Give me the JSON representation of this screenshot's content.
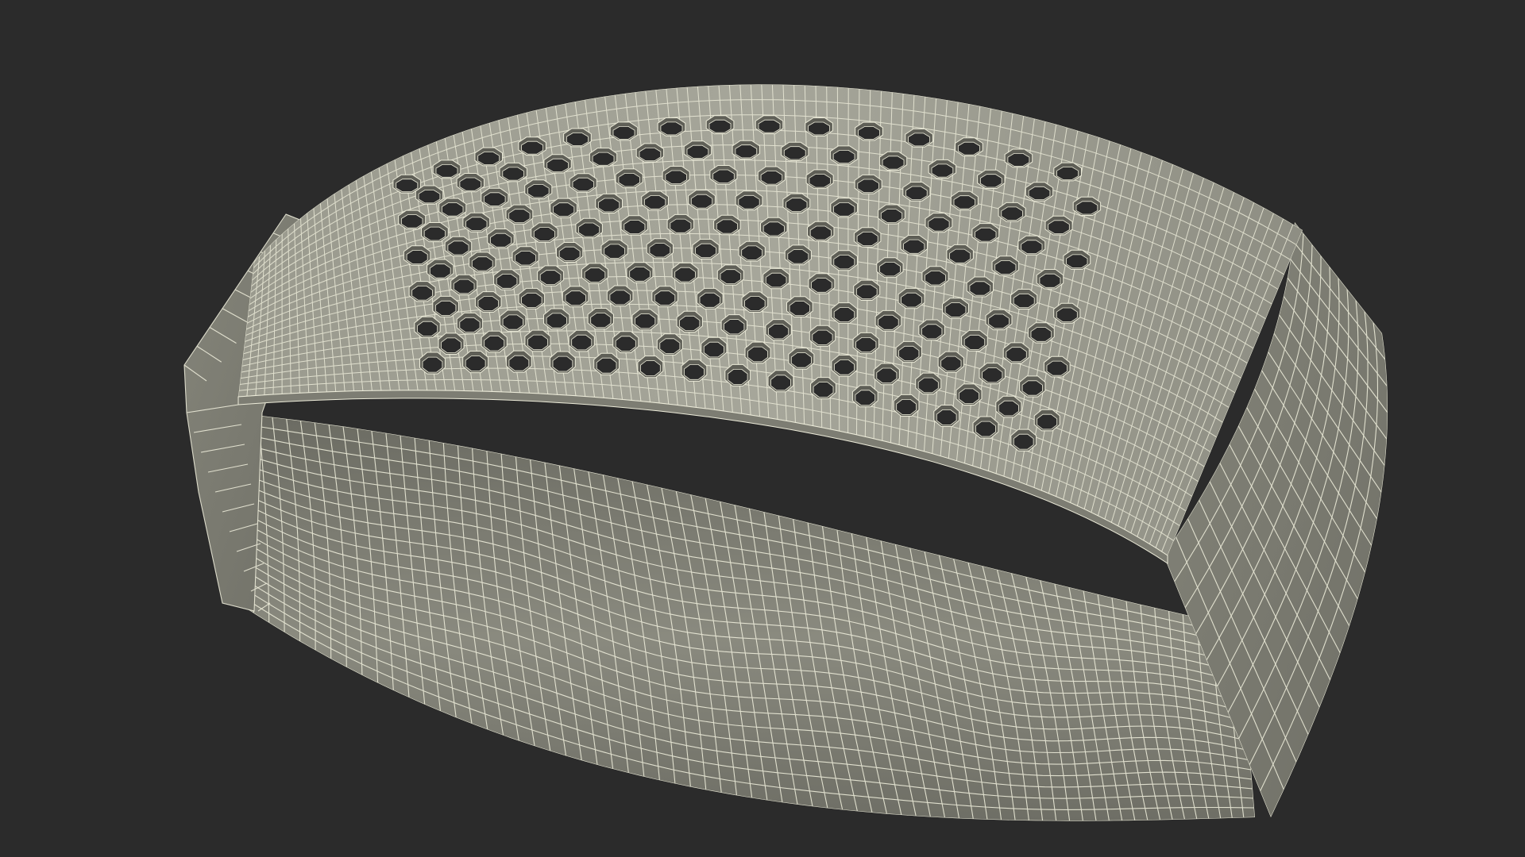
{
  "scene": {
    "background": "#2b2b2b",
    "model_color": "#8e8e82",
    "model_shade": "#6a6a61",
    "model_highlight": "#b0b0a4",
    "wire_color": "#ecebd9",
    "hole_color": "#2b2b2b"
  }
}
